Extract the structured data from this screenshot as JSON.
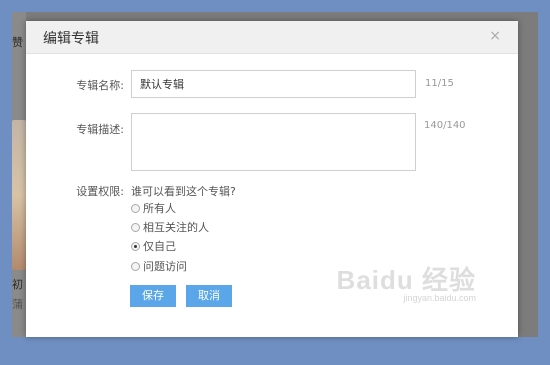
{
  "background": {
    "left_text_top": "赞",
    "left_text_mid1": "初",
    "left_text_mid2": "蒲"
  },
  "dialog": {
    "title": "编辑专辑",
    "close_glyph": "×",
    "name_label": "专辑名称:",
    "name_value": "默认专辑",
    "name_count": "11/15",
    "desc_label": "专辑描述:",
    "desc_value": "",
    "desc_count": "140/140",
    "perm_label": "设置权限:",
    "perm_question": "谁可以看到这个专辑?",
    "options": [
      {
        "label": "所有人",
        "checked": false
      },
      {
        "label": "相互关注的人",
        "checked": false
      },
      {
        "label": "仅自己",
        "checked": true
      },
      {
        "label": "问题访问",
        "checked": false
      }
    ],
    "save_label": "保存",
    "cancel_label": "取消"
  },
  "watermark": {
    "main": "Baidu 经验",
    "sub": "jingyan.baidu.com"
  }
}
